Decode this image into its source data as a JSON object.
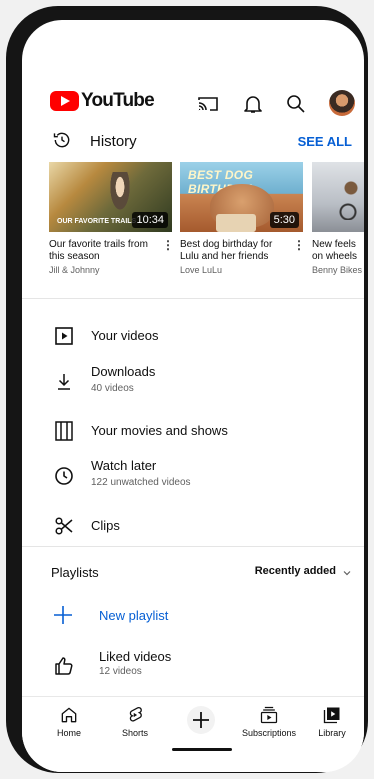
{
  "header": {
    "logo_text": "YouTube",
    "icons": [
      "cast-icon",
      "bell-icon",
      "search-icon",
      "avatar"
    ]
  },
  "history": {
    "title": "History",
    "see_all": "SEE ALL",
    "cards": [
      {
        "title": "Our favorite trails from this season",
        "channel": "Jill & Johnny",
        "duration": "10:34",
        "overlay": "OUR FAVORITE TRAILS"
      },
      {
        "title": "Best dog birthday for Lulu and her friends",
        "channel": "Love LuLu",
        "duration": "5:30",
        "overlay": "BEST DOG BIRTHDAY"
      },
      {
        "title": "New feels on wheels",
        "channel": "Benny Bikes"
      }
    ]
  },
  "library": {
    "your_videos": "Your videos",
    "downloads": "Downloads",
    "downloads_sub": "40 videos",
    "movies": "Your movies and shows",
    "watch_later": "Watch later",
    "watch_later_sub": "122 unwatched videos",
    "clips": "Clips"
  },
  "playlists": {
    "title": "Playlists",
    "sort": "Recently added",
    "new_playlist": "New playlist",
    "liked": "Liked videos",
    "liked_sub": "12 videos"
  },
  "nav": {
    "home": "Home",
    "shorts": "Shorts",
    "subscriptions": "Subscriptions",
    "library": "Library"
  },
  "colors": {
    "brand_red": "#ff0000",
    "link_blue": "#065fd4"
  }
}
